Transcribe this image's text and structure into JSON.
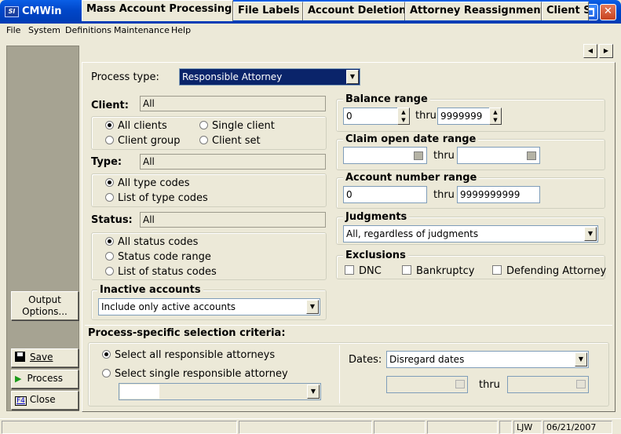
{
  "window": {
    "title": "CMWin",
    "icon_text": "SI"
  },
  "menu": [
    "File",
    "System",
    "Definitions",
    "Maintenance",
    "Help"
  ],
  "side_buttons": {
    "output_options": "Output Options...",
    "save": "Save",
    "process": "Process",
    "close": "Close"
  },
  "tabs": [
    "Mass Account Processing",
    "File Labels",
    "Account Deletion",
    "Attorney Reassignment",
    "Client S"
  ],
  "process_type": {
    "label": "Process type:",
    "value": "Responsible Attorney"
  },
  "client": {
    "label": "Client:",
    "value": "All",
    "options": [
      "All clients",
      "Single client",
      "Client group",
      "Client set"
    ],
    "selected": "All clients"
  },
  "type": {
    "label": "Type:",
    "value": "All",
    "options": [
      "All type codes",
      "List of type codes"
    ],
    "selected": "All type codes"
  },
  "status": {
    "label": "Status:",
    "value": "All",
    "options": [
      "All status codes",
      "Status code range",
      "List of status codes"
    ],
    "selected": "All status codes"
  },
  "inactive": {
    "label": "Inactive accounts",
    "value": "Include only active accounts"
  },
  "balance": {
    "label": "Balance range",
    "from": "0",
    "thru_label": "thru",
    "to": "9999999"
  },
  "claim_open": {
    "label": "Claim open date range",
    "thru_label": "thru"
  },
  "account_number": {
    "label": "Account number range",
    "from": "0",
    "thru_label": "thru",
    "to": "9999999999"
  },
  "judgments": {
    "label": "Judgments",
    "value": "All, regardless of judgments"
  },
  "exclusions": {
    "label": "Exclusions",
    "items": [
      "DNC",
      "Bankruptcy",
      "Defending Attorney"
    ]
  },
  "process_specific": {
    "label": "Process-specific selection criteria:",
    "options": [
      "Select all responsible attorneys",
      "Select single responsible attorney"
    ],
    "selected": "Select all responsible attorneys",
    "dates_label": "Dates:",
    "dates_value": "Disregard dates",
    "thru_label": "thru"
  },
  "statusbar": {
    "user": "LJW",
    "date": "06/21/2007"
  }
}
